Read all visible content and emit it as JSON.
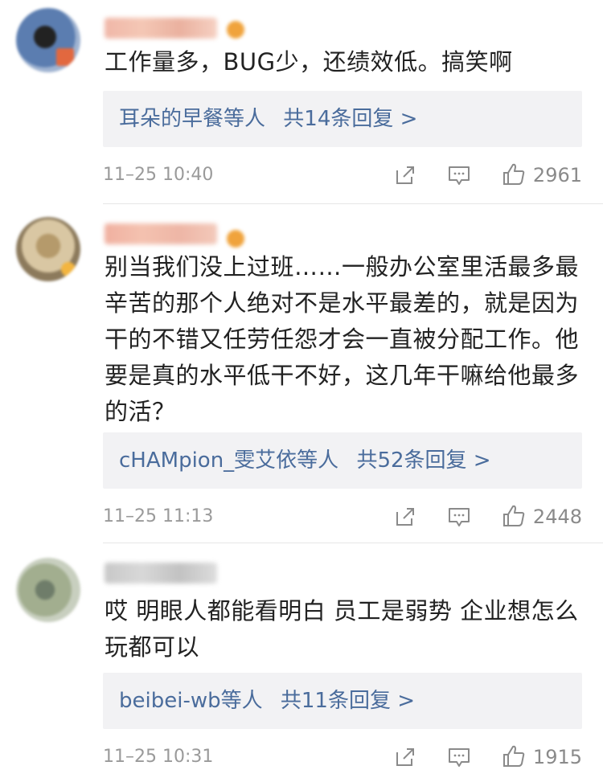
{
  "comments": [
    {
      "text": "工作量多，BUG少，还绩效低。搞笑啊",
      "replies": {
        "users": "耳朵的早餐等人",
        "summary": "共14条回复 >"
      },
      "time": "11–25 10:40",
      "likes": "2961"
    },
    {
      "text": "别当我们没上过班……一般办公室里活最多最辛苦的那个人绝对不是水平最差的，就是因为干的不错又任劳任怨才会一直被分配工作。他要是真的水平低干不好，这几年干嘛给他最多的活？",
      "replies": {
        "users": "cHAMpion_雯艾依等人",
        "summary": "共52条回复 >"
      },
      "time": "11–25 11:13",
      "likes": "2448"
    },
    {
      "text": "哎 明眼人都能看明白 员工是弱势 企业想怎么玩都可以",
      "replies": {
        "users": "beibei-wb等人",
        "summary": "共11条回复 >"
      },
      "time": "11–25 10:31",
      "likes": "1915"
    }
  ],
  "icons": {
    "share": "share-icon",
    "comment": "comment-icon",
    "like": "thumbs-up-icon"
  },
  "colors": {
    "link": "#4a6c9c",
    "meta": "#9a9a9a",
    "reply_bg": "#f2f2f4"
  }
}
